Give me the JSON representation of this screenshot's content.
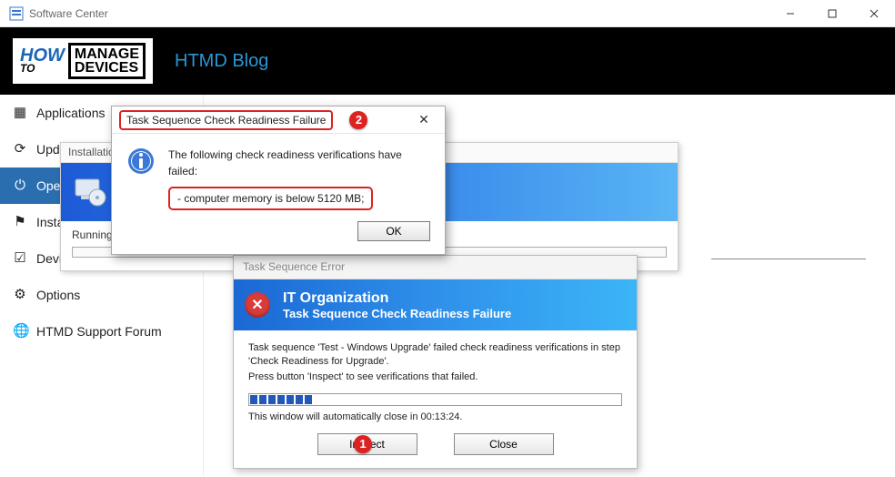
{
  "window": {
    "title": "Software Center"
  },
  "banner": {
    "logo_how": "HOW",
    "logo_to": "TO",
    "logo_manage": "MANAGE",
    "logo_devices": "DEVICES",
    "blog_title": "HTMD Blog"
  },
  "sidebar": {
    "items": [
      {
        "label": "Applications"
      },
      {
        "label": "Updates"
      },
      {
        "label": "Operating Systems"
      },
      {
        "label": "Installation status"
      },
      {
        "label": "Device compliance"
      },
      {
        "label": "Options"
      },
      {
        "label": "HTMD Support Forum"
      }
    ]
  },
  "install_popup": {
    "title": "Installation Progress",
    "running_label": "Running actions"
  },
  "tserr": {
    "title": "Task Sequence Error",
    "org": "IT Organization",
    "sub": "Task Sequence Check Readiness Failure",
    "line1": "Task sequence 'Test - Windows Upgrade' failed check readiness verifications in step 'Check Readiness for Upgrade'.",
    "line2": "Press button 'Inspect' to see verifications that failed.",
    "auto": "This window will automatically close in 00:13:24.",
    "inspect_label": "Inspect",
    "close_label": "Close"
  },
  "fail_dlg": {
    "title": "Task Sequence Check Readiness Failure",
    "heading": "The following check readiness verifications have failed:",
    "reason": "- computer memory is below 5120 MB;",
    "ok_label": "OK"
  },
  "callouts": {
    "one": "1",
    "two": "2"
  }
}
